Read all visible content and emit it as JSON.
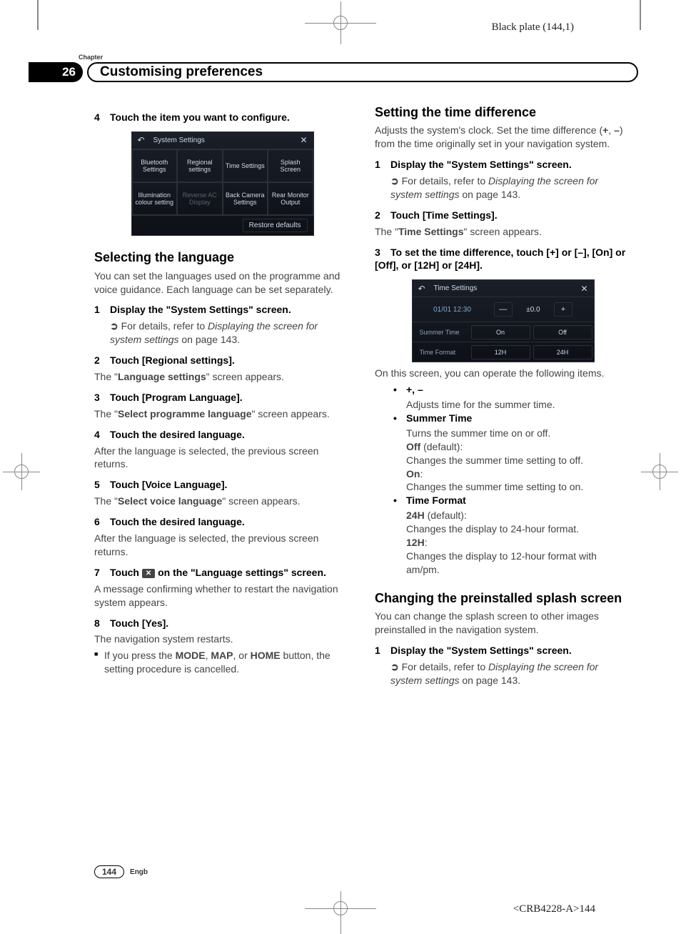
{
  "plate": "Black plate (144,1)",
  "chapter_label": "Chapter",
  "chapter_number": "26",
  "chapter_title": "Customising preferences",
  "left": {
    "step4_num": "4",
    "step4_text": "Touch the item you want to configure.",
    "ss1": {
      "title": "System Settings",
      "cells": [
        "Bluetooth Settings",
        "Regional settings",
        "Time Settings",
        "Splash Screen",
        "Illumination colour setting",
        "Reverse AC Display",
        "Back Camera Settings",
        "Rear Monitor Output"
      ],
      "restore": "Restore defaults"
    },
    "h_lang": "Selecting the language",
    "lang_intro": "You can set the languages used on the programme and voice guidance. Each language can be set separately.",
    "s1_num": "1",
    "s1_text": "Display the \"System Settings\" screen.",
    "s1_sub_prefix": "For details, refer to ",
    "s1_sub_italic": "Displaying the screen for system settings",
    "s1_sub_suffix": " on page 143.",
    "s2_num": "2",
    "s2_text": "Touch [Regional settings].",
    "s2_body_pre": "The \"",
    "s2_body_bold": "Language settings",
    "s2_body_post": "\" screen appears.",
    "s3_num": "3",
    "s3_text": "Touch [Program Language].",
    "s3_body_pre": "The \"",
    "s3_body_bold": "Select programme language",
    "s3_body_post": "\" screen appears.",
    "s4_num": "4",
    "s4_text": "Touch the desired language.",
    "s4_body": "After the language is selected, the previous screen returns.",
    "s5_num": "5",
    "s5_text": "Touch [Voice Language].",
    "s5_body_pre": "The \"",
    "s5_body_bold": "Select voice language",
    "s5_body_post": "\" screen appears.",
    "s6_num": "6",
    "s6_text": "Touch the desired language.",
    "s6_body": "After the language is selected, the previous screen returns.",
    "s7_num": "7",
    "s7_text_pre": "Touch ",
    "s7_text_post": " on the \"Language settings\" screen.",
    "s7_body": "A message confirming whether to restart the navigation system appears.",
    "s8_num": "8",
    "s8_text": "Touch [Yes].",
    "s8_body": "The navigation system restarts.",
    "note_pre": "If you press the ",
    "note_b1": "MODE",
    "note_mid1": ", ",
    "note_b2": "MAP",
    "note_mid2": ", or ",
    "note_b3": "HOME",
    "note_post": " button, the setting procedure is cancelled."
  },
  "right": {
    "h_time": "Setting the time difference",
    "time_intro_1": "Adjusts the system's clock. Set the time difference (",
    "time_intro_b1": "+",
    "time_intro_m": ", ",
    "time_intro_b2": "–",
    "time_intro_2": ") from the time originally set in your navigation system.",
    "t1_num": "1",
    "t1_text": "Display the \"System Settings\" screen.",
    "t1_sub_prefix": "For details, refer to ",
    "t1_sub_italic": "Displaying the screen for system settings",
    "t1_sub_suffix": " on page 143.",
    "t2_num": "2",
    "t2_text": "Touch [Time Settings].",
    "t2_body_pre": "The \"",
    "t2_body_bold": "Time Settings",
    "t2_body_post": "\" screen appears.",
    "t3_num": "3",
    "t3_text": "To set the time difference, touch [+] or [–], [On] or [Off], or [12H] or [24H].",
    "ss2": {
      "title": "Time Settings",
      "datetime": "01/01 12:30",
      "minus": "—",
      "val": "±0.0",
      "plus": "+",
      "row1_label": "Summer Time",
      "row1_on": "On",
      "row1_off": "Off",
      "row2_label": "Time Format",
      "row2_a": "12H",
      "row2_b": "24H"
    },
    "operate": "On this screen, you can operate the following items.",
    "b1_title": "+, –",
    "b1_body": "Adjusts time for the summer time.",
    "b2_title": "Summer Time",
    "b2_l1": "Turns the summer time on or off.",
    "b2_off": "Off",
    "b2_off_post": " (default):",
    "b2_off_body": "Changes the summer time setting to off.",
    "b2_on": "On",
    "b2_on_post": ":",
    "b2_on_body": "Changes the summer time setting to on.",
    "b3_title": "Time Format",
    "b3_24": "24H",
    "b3_24_post": " (default):",
    "b3_24_body": "Changes the display to 24-hour format.",
    "b3_12": "12H",
    "b3_12_post": ":",
    "b3_12_body": "Changes the display to 12-hour format with am/pm.",
    "h_splash": "Changing the preinstalled splash screen",
    "splash_intro": "You can change the splash screen to other images preinstalled in the navigation system.",
    "sp1_num": "1",
    "sp1_text": "Display the \"System Settings\" screen.",
    "sp1_sub_prefix": "For details, refer to ",
    "sp1_sub_italic": "Displaying the screen for system settings",
    "sp1_sub_suffix": " on page 143."
  },
  "footer": {
    "page": "144",
    "lang": "Engb"
  },
  "doc_code": "<CRB4228-A>144"
}
